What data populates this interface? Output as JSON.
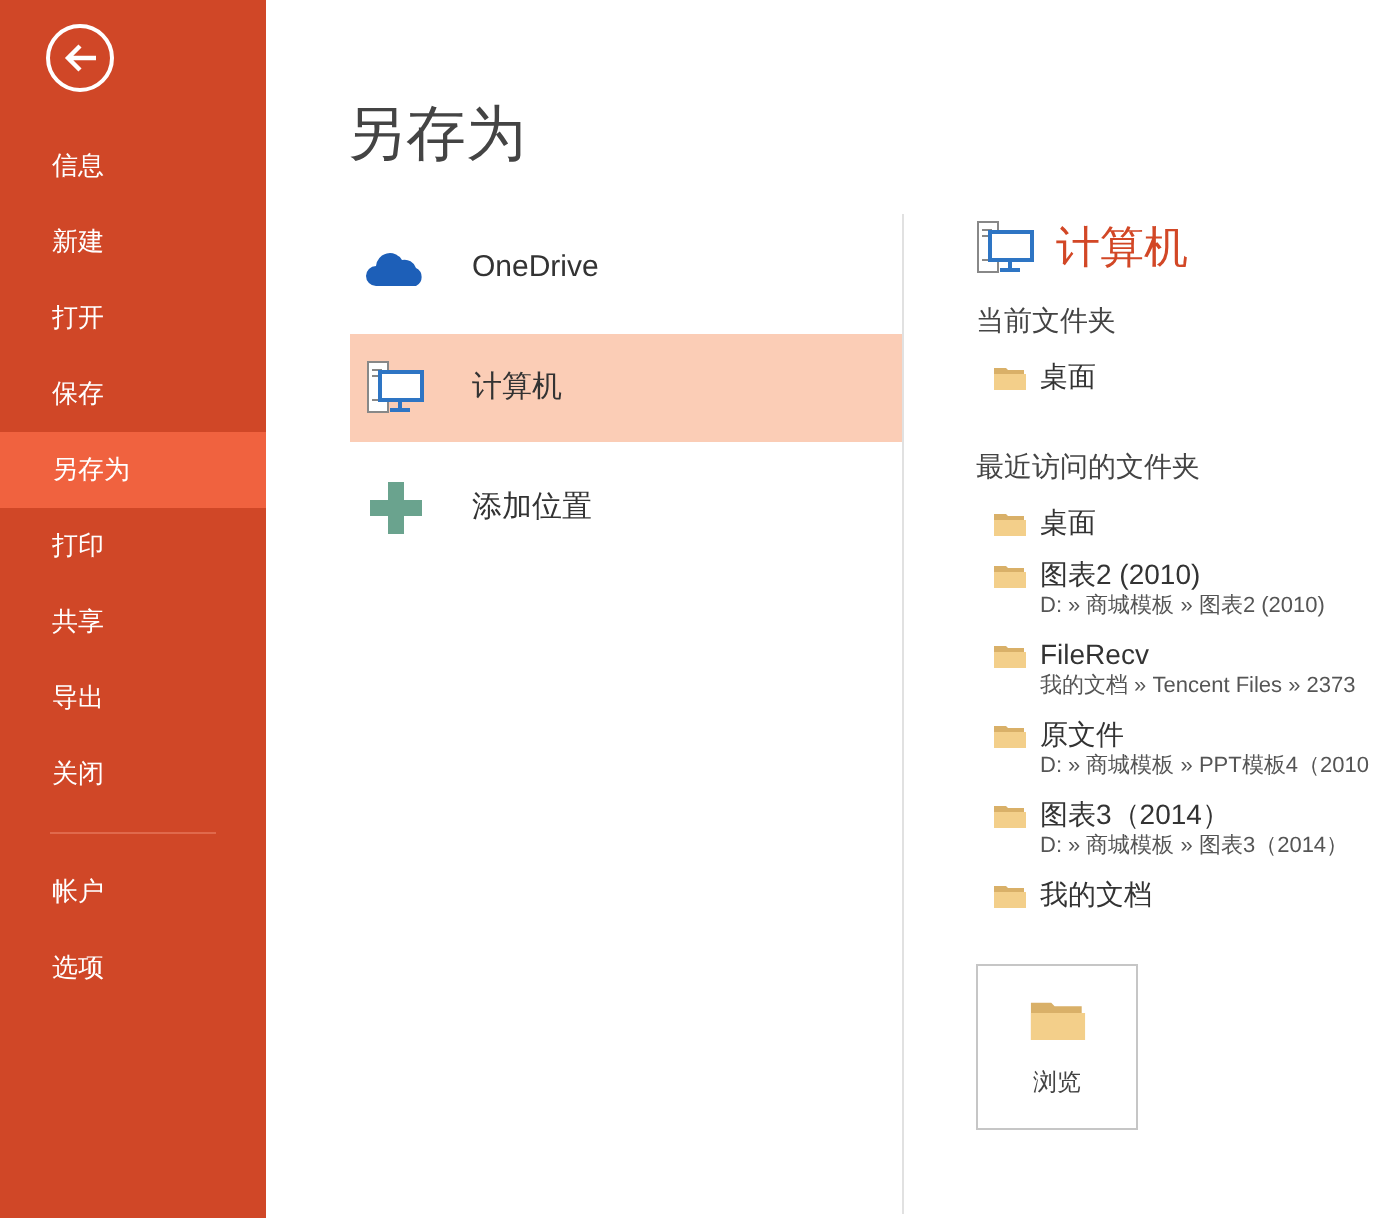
{
  "sidebar": {
    "items": [
      {
        "label": "信息",
        "selected": false
      },
      {
        "label": "新建",
        "selected": false
      },
      {
        "label": "打开",
        "selected": false
      },
      {
        "label": "保存",
        "selected": false
      },
      {
        "label": "另存为",
        "selected": true
      },
      {
        "label": "打印",
        "selected": false
      },
      {
        "label": "共享",
        "selected": false
      },
      {
        "label": "导出",
        "selected": false
      },
      {
        "label": "关闭",
        "selected": false
      }
    ],
    "bottom_items": [
      {
        "label": "帐户",
        "selected": false
      },
      {
        "label": "选项",
        "selected": false
      }
    ]
  },
  "title": "另存为",
  "places": [
    {
      "kind": "cloud",
      "label": "OneDrive",
      "selected": false
    },
    {
      "kind": "computer",
      "label": "计算机",
      "selected": true
    },
    {
      "kind": "add",
      "label": "添加位置",
      "selected": false
    }
  ],
  "panel": {
    "title": "计算机",
    "current_heading": "当前文件夹",
    "current": [
      {
        "name": "桌面"
      }
    ],
    "recent_heading": "最近访问的文件夹",
    "recent": [
      {
        "name": "桌面"
      },
      {
        "name": "图表2 (2010)",
        "path": "D: » 商城模板 » 图表2 (2010)"
      },
      {
        "name": "FileRecv",
        "path": "我的文档 » Tencent Files » 2373"
      },
      {
        "name": "原文件",
        "path": "D: » 商城模板 » PPT模板4（2010"
      },
      {
        "name": "图表3（2014）",
        "path": "D: » 商城模板 » 图表3（2014）"
      },
      {
        "name": "我的文档"
      }
    ],
    "browse": "浏览"
  }
}
